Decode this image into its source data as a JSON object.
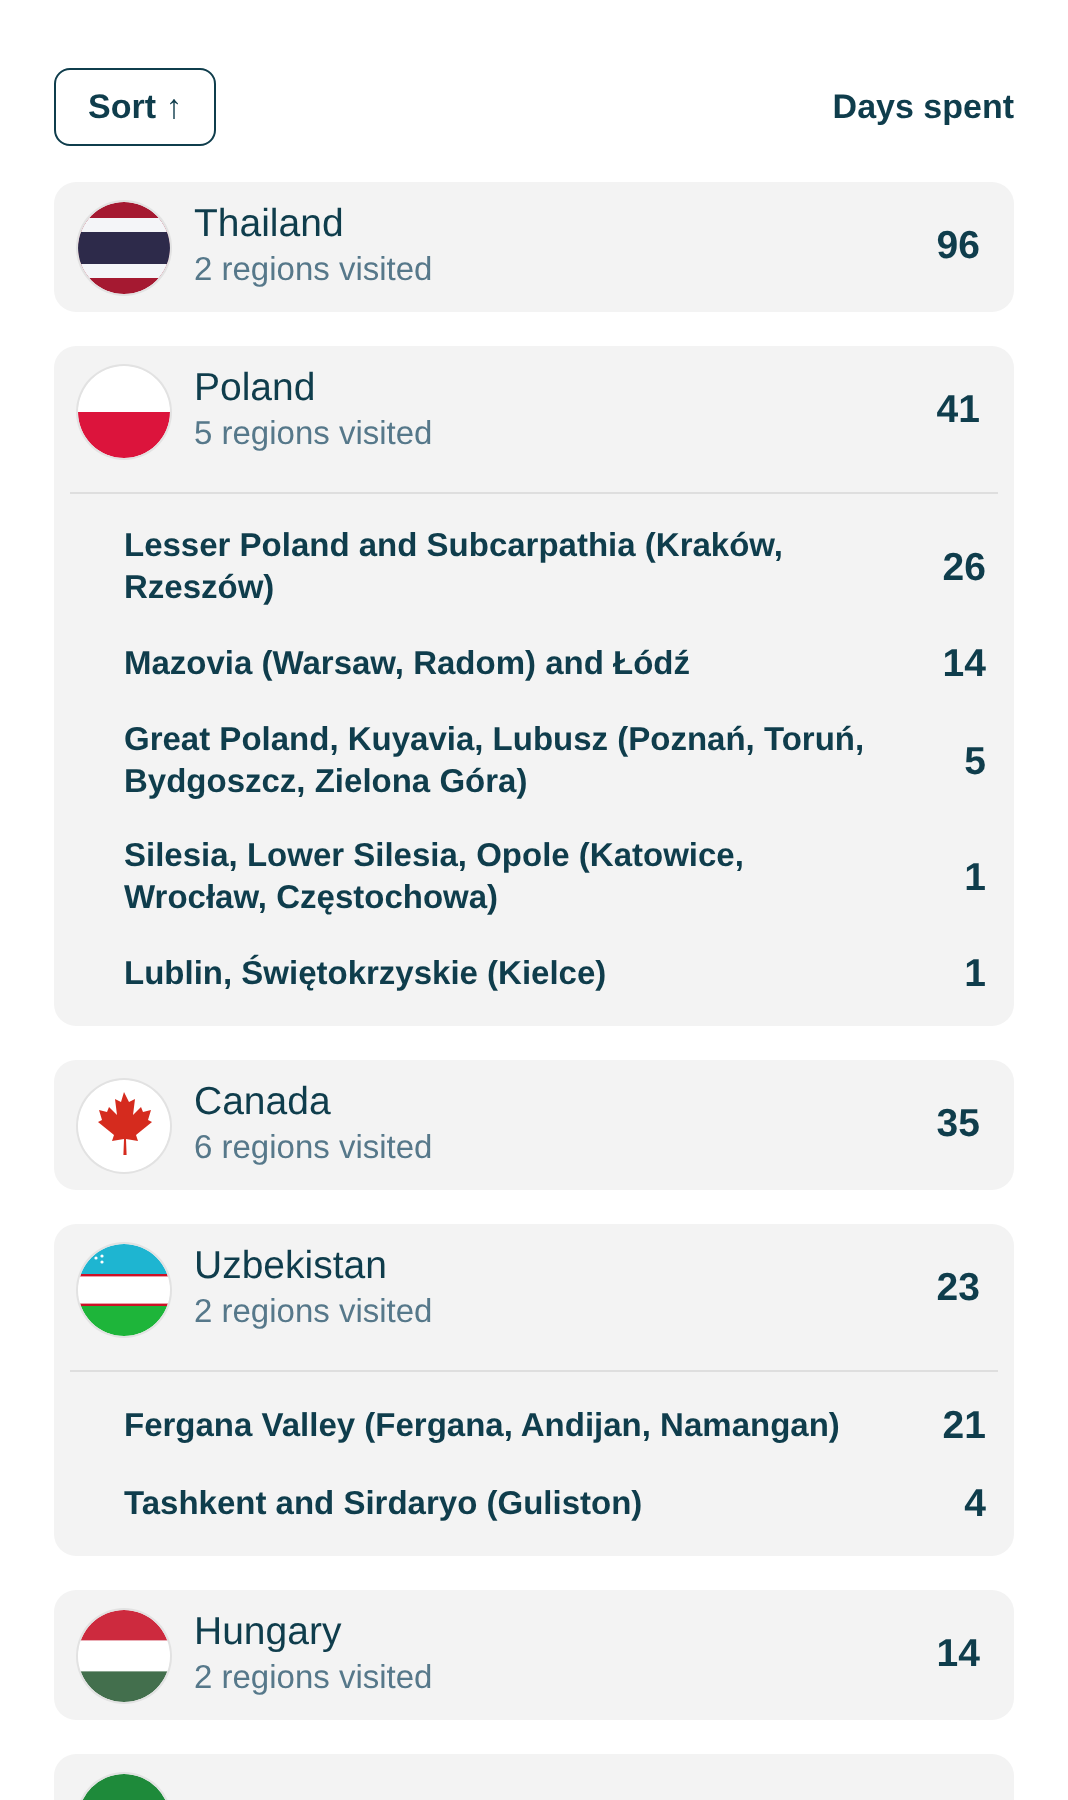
{
  "sort_button": {
    "label": "Sort ↑"
  },
  "column_header": "Days spent",
  "countries": [
    {
      "kind": "th",
      "name": "Thailand",
      "subtitle": "2 regions visited",
      "days": "96",
      "expanded": false
    },
    {
      "kind": "pl",
      "name": "Poland",
      "subtitle": "5 regions visited",
      "days": "41",
      "expanded": true,
      "regions": [
        {
          "name": "Lesser Poland and Subcarpathia (Kraków, Rzeszów)",
          "days": "26"
        },
        {
          "name": "Mazovia (Warsaw, Radom) and Łódź",
          "days": "14"
        },
        {
          "name": "Great Poland, Kuyavia, Lubusz (Poznań, Toruń, Bydgoszcz, Zielona Góra)",
          "days": "5"
        },
        {
          "name": "Silesia, Lower Silesia, Opole (Katowice, Wrocław, Częstochowa)",
          "days": "1"
        },
        {
          "name": "Lublin, Świętokrzyskie (Kielce)",
          "days": "1"
        }
      ]
    },
    {
      "kind": "ca",
      "name": "Canada",
      "subtitle": "6 regions visited",
      "days": "35",
      "expanded": false
    },
    {
      "kind": "uz",
      "name": "Uzbekistan",
      "subtitle": "2 regions visited",
      "days": "23",
      "expanded": true,
      "regions": [
        {
          "name": "Fergana Valley (Fergana, Andijan, Namangan)",
          "days": "21"
        },
        {
          "name": "Tashkent and Sirdaryo (Guliston)",
          "days": "4"
        }
      ]
    },
    {
      "kind": "hu",
      "name": "Hungary",
      "subtitle": "2 regions visited",
      "days": "14",
      "expanded": false
    },
    {
      "kind": "green",
      "expanded": false
    }
  ]
}
